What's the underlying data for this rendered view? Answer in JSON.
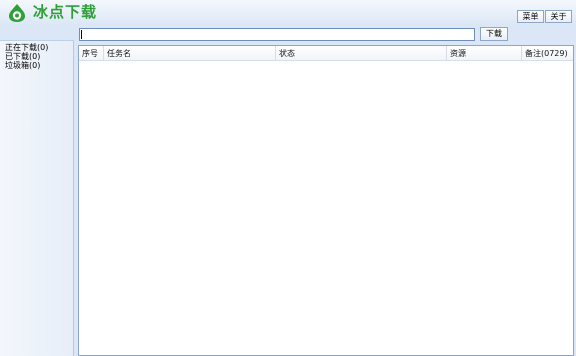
{
  "app": {
    "title": "冰点下载",
    "logo_icon": "green-droplet-logo-icon"
  },
  "top_buttons": {
    "menu": "菜单",
    "about": "关于"
  },
  "search": {
    "value": "",
    "placeholder": "",
    "download_label": "下载"
  },
  "sidebar": {
    "items": [
      {
        "label": "正在下载(0)"
      },
      {
        "label": "已下载(0)"
      },
      {
        "label": "垃圾箱(0)"
      }
    ]
  },
  "table": {
    "columns": [
      "序号",
      "任务名",
      "状态",
      "资源",
      "备注(0729)"
    ],
    "rows": []
  },
  "colors": {
    "background": "#dbe7f6",
    "accent": "#2f9f3a",
    "border": "#8ea6c5"
  }
}
